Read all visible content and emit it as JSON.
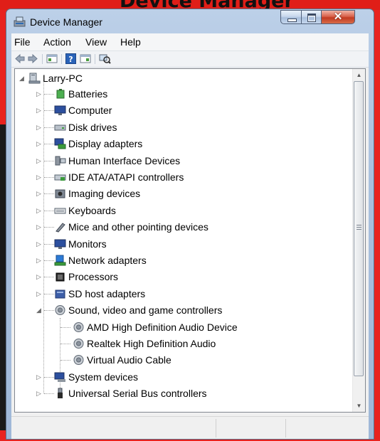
{
  "window": {
    "title": "Device Manager"
  },
  "menu": [
    "File",
    "Action",
    "View",
    "Help"
  ],
  "toolbar": {
    "buttons": [
      {
        "name": "back-icon"
      },
      {
        "name": "forward-icon"
      },
      {
        "name": "show-hide-console-tree-icon"
      },
      {
        "name": "help-icon"
      },
      {
        "name": "properties-icon"
      },
      {
        "name": "scan-hardware-changes-icon"
      }
    ]
  },
  "tree": {
    "root": {
      "label": "Larry-PC",
      "icon": "computer-icon",
      "expanded": true
    },
    "categories": [
      {
        "label": "Batteries",
        "icon": "battery-icon",
        "expanded": false
      },
      {
        "label": "Computer",
        "icon": "monitor-icon",
        "expanded": false
      },
      {
        "label": "Disk drives",
        "icon": "disk-drive-icon",
        "expanded": false
      },
      {
        "label": "Display adapters",
        "icon": "display-adapter-icon",
        "expanded": false
      },
      {
        "label": "Human Interface Devices",
        "icon": "hid-icon",
        "expanded": false
      },
      {
        "label": "IDE ATA/ATAPI controllers",
        "icon": "ide-controller-icon",
        "expanded": false
      },
      {
        "label": "Imaging devices",
        "icon": "imaging-device-icon",
        "expanded": false
      },
      {
        "label": "Keyboards",
        "icon": "keyboard-icon",
        "expanded": false
      },
      {
        "label": "Mice and other pointing devices",
        "icon": "mouse-icon",
        "expanded": false
      },
      {
        "label": "Monitors",
        "icon": "monitor-icon",
        "expanded": false
      },
      {
        "label": "Network adapters",
        "icon": "network-adapter-icon",
        "expanded": false
      },
      {
        "label": "Processors",
        "icon": "processor-icon",
        "expanded": false
      },
      {
        "label": "SD host adapters",
        "icon": "sd-host-icon",
        "expanded": false
      },
      {
        "label": "Sound, video and game controllers",
        "icon": "speaker-icon",
        "expanded": true,
        "children": [
          {
            "label": "AMD High Definition Audio Device",
            "icon": "speaker-icon"
          },
          {
            "label": "Realtek High Definition Audio",
            "icon": "speaker-icon"
          },
          {
            "label": "Virtual Audio Cable",
            "icon": "speaker-icon"
          }
        ]
      },
      {
        "label": "System devices",
        "icon": "system-devices-icon",
        "expanded": false
      },
      {
        "label": "Universal Serial Bus controllers",
        "icon": "usb-icon",
        "expanded": false
      }
    ]
  },
  "colors": {
    "background": "#e8231f",
    "window_frame": "#a9c0de",
    "close_button": "#c23a21"
  }
}
